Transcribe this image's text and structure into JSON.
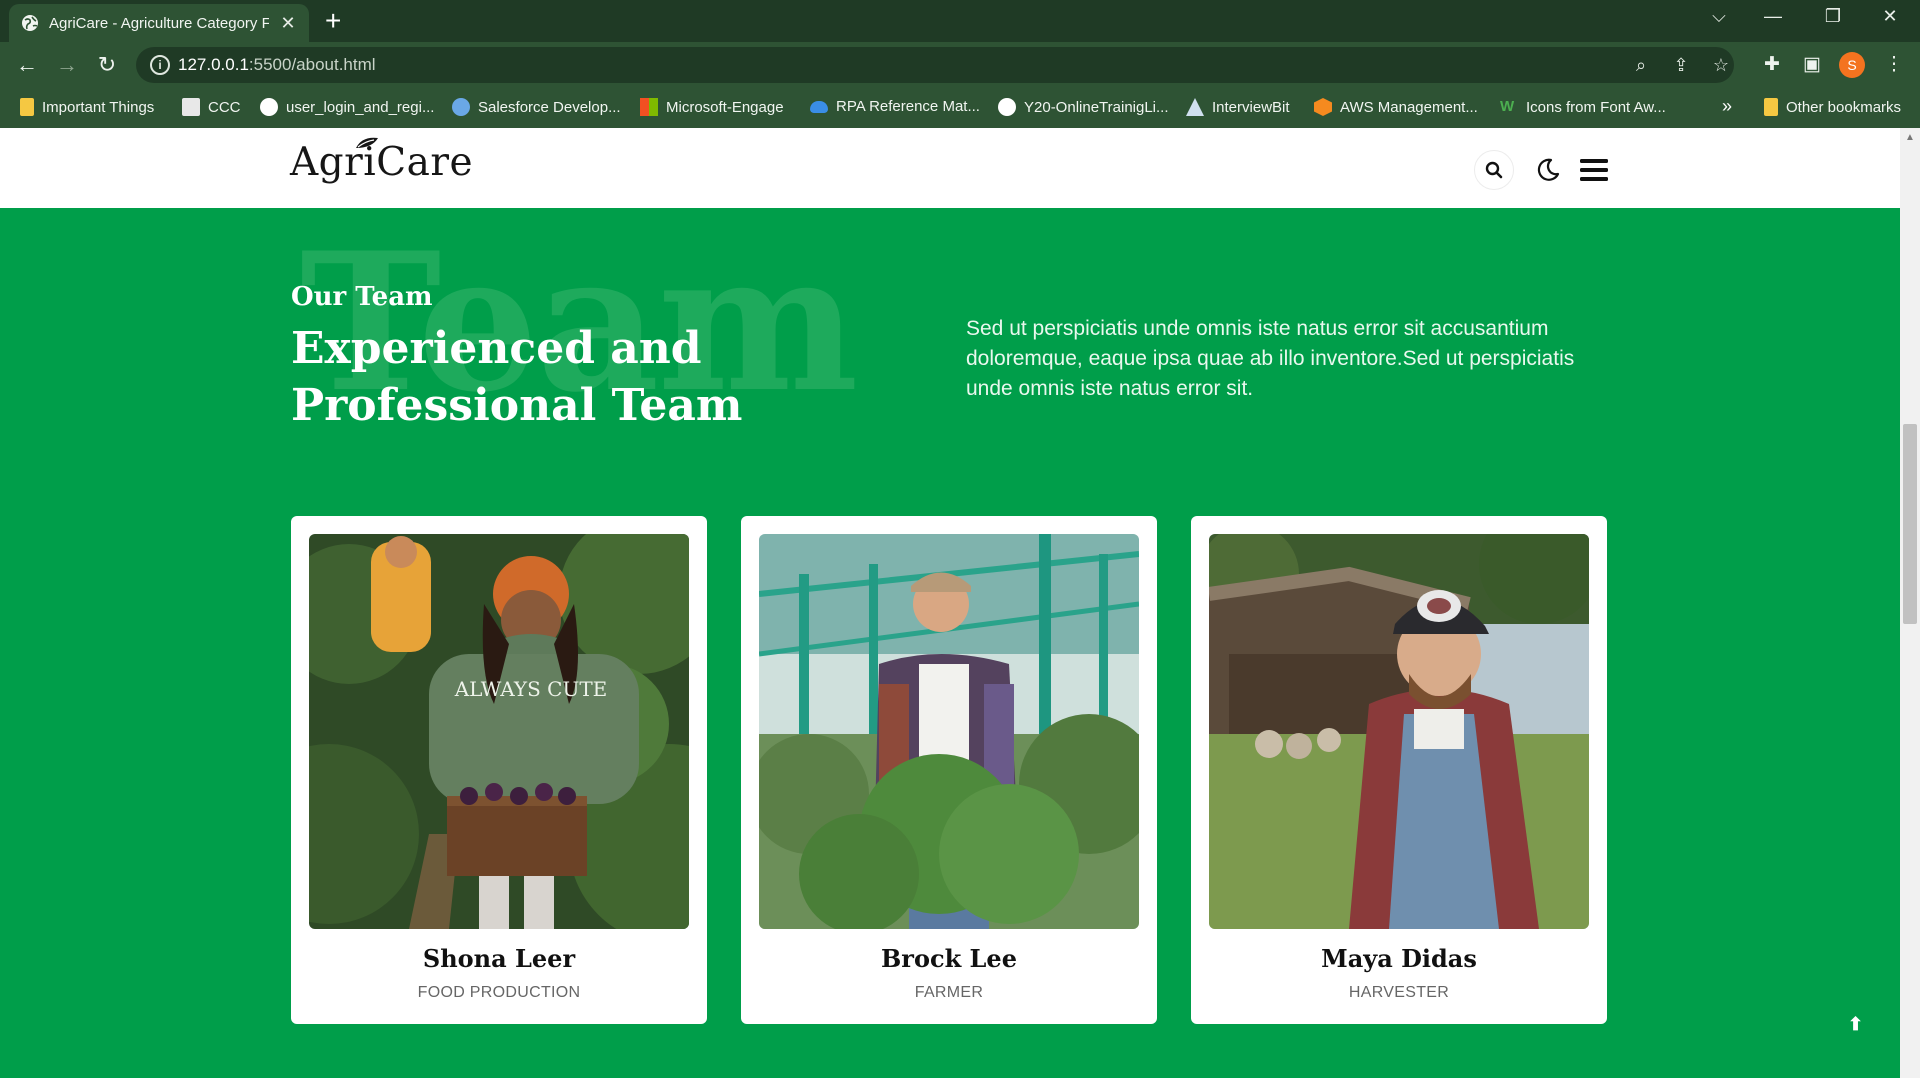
{
  "browser": {
    "tab_title": "AgriCare - Agriculture Category F",
    "url_host": "127.0.0.1",
    "url_path": ":5500/about.html",
    "profile_initial": "S",
    "bookmarks": [
      "Important Things",
      "CCC",
      "user_login_and_regi...",
      "Salesforce Develop...",
      "Microsoft-Engage",
      "RPA Reference Mat...",
      "Y20-OnlineTrainigLi...",
      "InterviewBit",
      "AWS Management...",
      "Icons from Font Aw..."
    ],
    "more_bookmarks": "»",
    "other_bookmarks": "Other bookmarks"
  },
  "site": {
    "logo": "AgriCare",
    "brand_color": "#009e4a"
  },
  "team": {
    "watermark": "Team",
    "eyebrow": "Our Team",
    "heading": "Experienced and Professional Team",
    "intro": "Sed ut perspiciatis unde omnis iste natus error sit accusantium doloremque, eaque ipsa quae ab illo inventore.Sed ut perspiciatis unde omnis iste natus error sit.",
    "members": [
      {
        "name": "Shona Leer",
        "role": "FOOD PRODUCTION",
        "shirt_text": "ALWAYS CUTE"
      },
      {
        "name": "Brock Lee",
        "role": "FARMER"
      },
      {
        "name": "Maya Didas",
        "role": "HARVESTER"
      }
    ]
  },
  "scroll_top_icon": "arrow-up-icon"
}
